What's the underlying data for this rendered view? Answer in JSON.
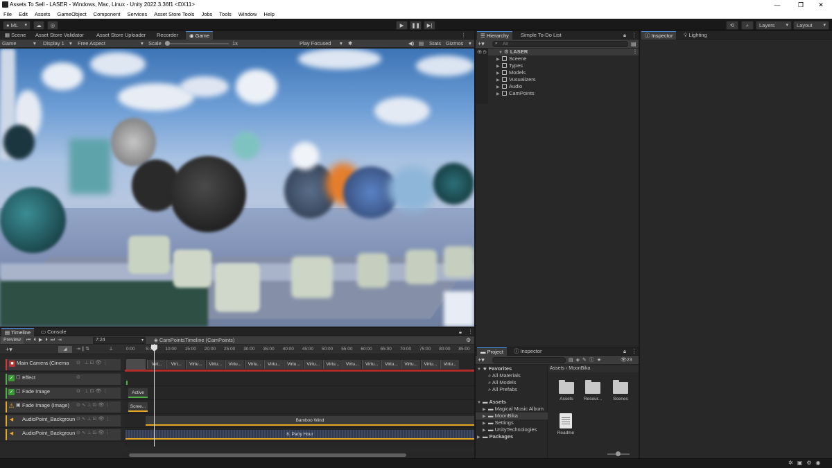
{
  "window": {
    "title": "Assets To Sell - LASER - Windows, Mac, Linux - Unity 2022.3.36f1 <DX11>",
    "minimize": "—",
    "restore": "❐",
    "close": "✕"
  },
  "menu": [
    "File",
    "Edit",
    "Assets",
    "GameObject",
    "Component",
    "Services",
    "Asset Store Tools",
    "Jobs",
    "Tools",
    "Window",
    "Help"
  ],
  "toolbar": {
    "account": "ML",
    "layers": "Layers",
    "layout": "Layout"
  },
  "scene_tabs": [
    "Scene",
    "Asset Store Validator",
    "Asset Store Uploader",
    "Recorder",
    "Game"
  ],
  "game_bar": {
    "view": "Game",
    "display": "Display 1",
    "aspect": "Free Aspect",
    "scale_label": "Scale",
    "scale_value": "1x",
    "play_mode": "Play Focused",
    "stats": "Stats",
    "gizmos": "Gizmos"
  },
  "hierarchy": {
    "tabs": [
      "Hierarchy",
      "Simple To-Do List"
    ],
    "search_placeholder": "All",
    "root": "LASER",
    "children": [
      "Sceene",
      "Types",
      "Models",
      "Vusualizers",
      "Audio",
      "CamPoints"
    ]
  },
  "inspector_tabs": [
    "Inspector",
    "Lighting"
  ],
  "timeline": {
    "tabs": [
      "Timeline",
      "Console"
    ],
    "preview": "Preview",
    "frame": "7:24",
    "asset": "CamPointsTimeline (CamPoints)",
    "ticks": [
      "0:00",
      "5:00",
      "10:00",
      "15:00",
      "20:00",
      "25:00",
      "30:00",
      "35:00",
      "40:00",
      "45:00",
      "50:00",
      "55:00",
      "60:00",
      "65:00",
      "70:00",
      "75:00",
      "80:00",
      "85:00"
    ],
    "tracks": [
      {
        "name": "Main Camera (Cinemachine Brain)",
        "color": "#d33a3a"
      },
      {
        "name": "Effect",
        "color": "#4fae47"
      },
      {
        "name": "Fade Image",
        "color": "#4fae47"
      },
      {
        "name": "Fade Image (Image)",
        "color": "#e8a823"
      },
      {
        "name": "AudioPoint_Background",
        "color": "#e8a823"
      },
      {
        "name": "AudioPoint_Background",
        "color": "#e8a823"
      }
    ],
    "camera_clips": [
      "Virt...",
      "Virt...",
      "Virtu...",
      "Virtu...",
      "Virtu...",
      "Virtu...",
      "Virtu...",
      "Virtu...",
      "Virtu...",
      "Virtu...",
      "Virtu...",
      "Virtu...",
      "Virtu...",
      "Virtu...",
      "Virtu...",
      "Virtu..."
    ],
    "active_clip": "Active",
    "screen_clip": "Scree...",
    "audio_clip_1": "Bamboo Wind",
    "audio_clip_2": "6. Party Hour"
  },
  "project": {
    "tabs": [
      "Project",
      "Inspector"
    ],
    "count": "23",
    "favorites_label": "Favorites",
    "favorites": [
      "All Materials",
      "All Models",
      "All Prefabs"
    ],
    "assets_label": "Assets",
    "asset_folders": [
      "Magical Music Album",
      "MoonBika",
      "Settings",
      "UnityTechnologies"
    ],
    "packages_label": "Packages",
    "breadcrumb": [
      "Assets",
      "MoonBika"
    ],
    "items": [
      "Assets",
      "Resour...",
      "Scenes",
      "Readme"
    ]
  },
  "colors": {
    "accent": "#4d8de0",
    "panel": "#282828",
    "selection": "#2c5d87"
  }
}
